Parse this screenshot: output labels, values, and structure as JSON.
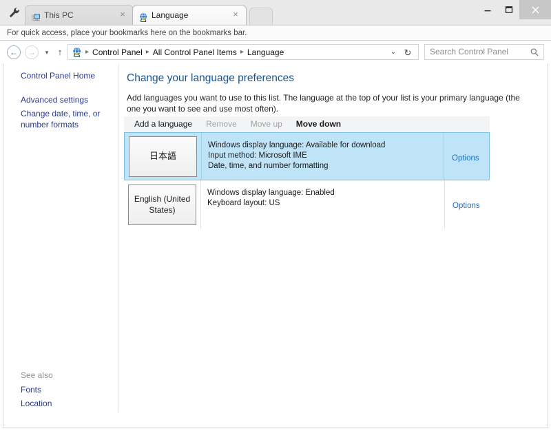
{
  "browser": {
    "tabs": [
      {
        "label": "This PC",
        "icon": "this-pc-icon",
        "active": false,
        "close": "×"
      },
      {
        "label": "Language",
        "icon": "language-globe-icon",
        "active": true,
        "close": "×"
      }
    ],
    "bookmark_bar_text": "For quick access, place your bookmarks here on the bookmarks bar.",
    "window_controls": {
      "minimize": "—",
      "maximize": "❐",
      "close": "✕"
    }
  },
  "navigation": {
    "back": "←",
    "forward": "→",
    "recent_pages": "▾",
    "up": "↑",
    "breadcrumb": [
      "Control Panel",
      "All Control Panel Items",
      "Language"
    ],
    "breadcrumb_separator": "▸",
    "breadcrumb_caret": "⌄",
    "refresh": "↻",
    "search_placeholder": "Search Control Panel",
    "search_value": "",
    "search_icon": "magnifier-icon"
  },
  "sidebar": {
    "links": [
      {
        "label": "Control Panel Home"
      },
      {
        "label": "Advanced settings"
      },
      {
        "label": "Change date, time, or number formats"
      }
    ],
    "see_also_title": "See also",
    "see_also_links": [
      {
        "label": "Fonts"
      },
      {
        "label": "Location"
      }
    ]
  },
  "main": {
    "title": "Change your language preferences",
    "description": "Add languages you want to use to this list. The language at the top of your list is your primary language (the one you want to see and use most often).",
    "toolbar": [
      {
        "label": "Add a language",
        "enabled": true,
        "bold": false
      },
      {
        "label": "Remove",
        "enabled": false,
        "bold": false
      },
      {
        "label": "Move up",
        "enabled": false,
        "bold": false
      },
      {
        "label": "Move down",
        "enabled": true,
        "bold": true
      }
    ],
    "languages": [
      {
        "tile": "日本語",
        "selected": true,
        "details": [
          "Windows display language: Available for download",
          "Input method: Microsoft IME",
          "Date, time, and number formatting"
        ],
        "options_label": "Options"
      },
      {
        "tile": "English (United States)",
        "selected": false,
        "details": [
          "Windows display language: Enabled",
          "Keyboard layout: US"
        ],
        "options_label": "Options"
      }
    ]
  },
  "colors": {
    "accent_blue": "#16558f",
    "link_blue": "#2b3a8f",
    "options_link": "#1e6fc4",
    "selection_fill": "#bfe4f7",
    "selection_border": "#7ec3e3"
  }
}
